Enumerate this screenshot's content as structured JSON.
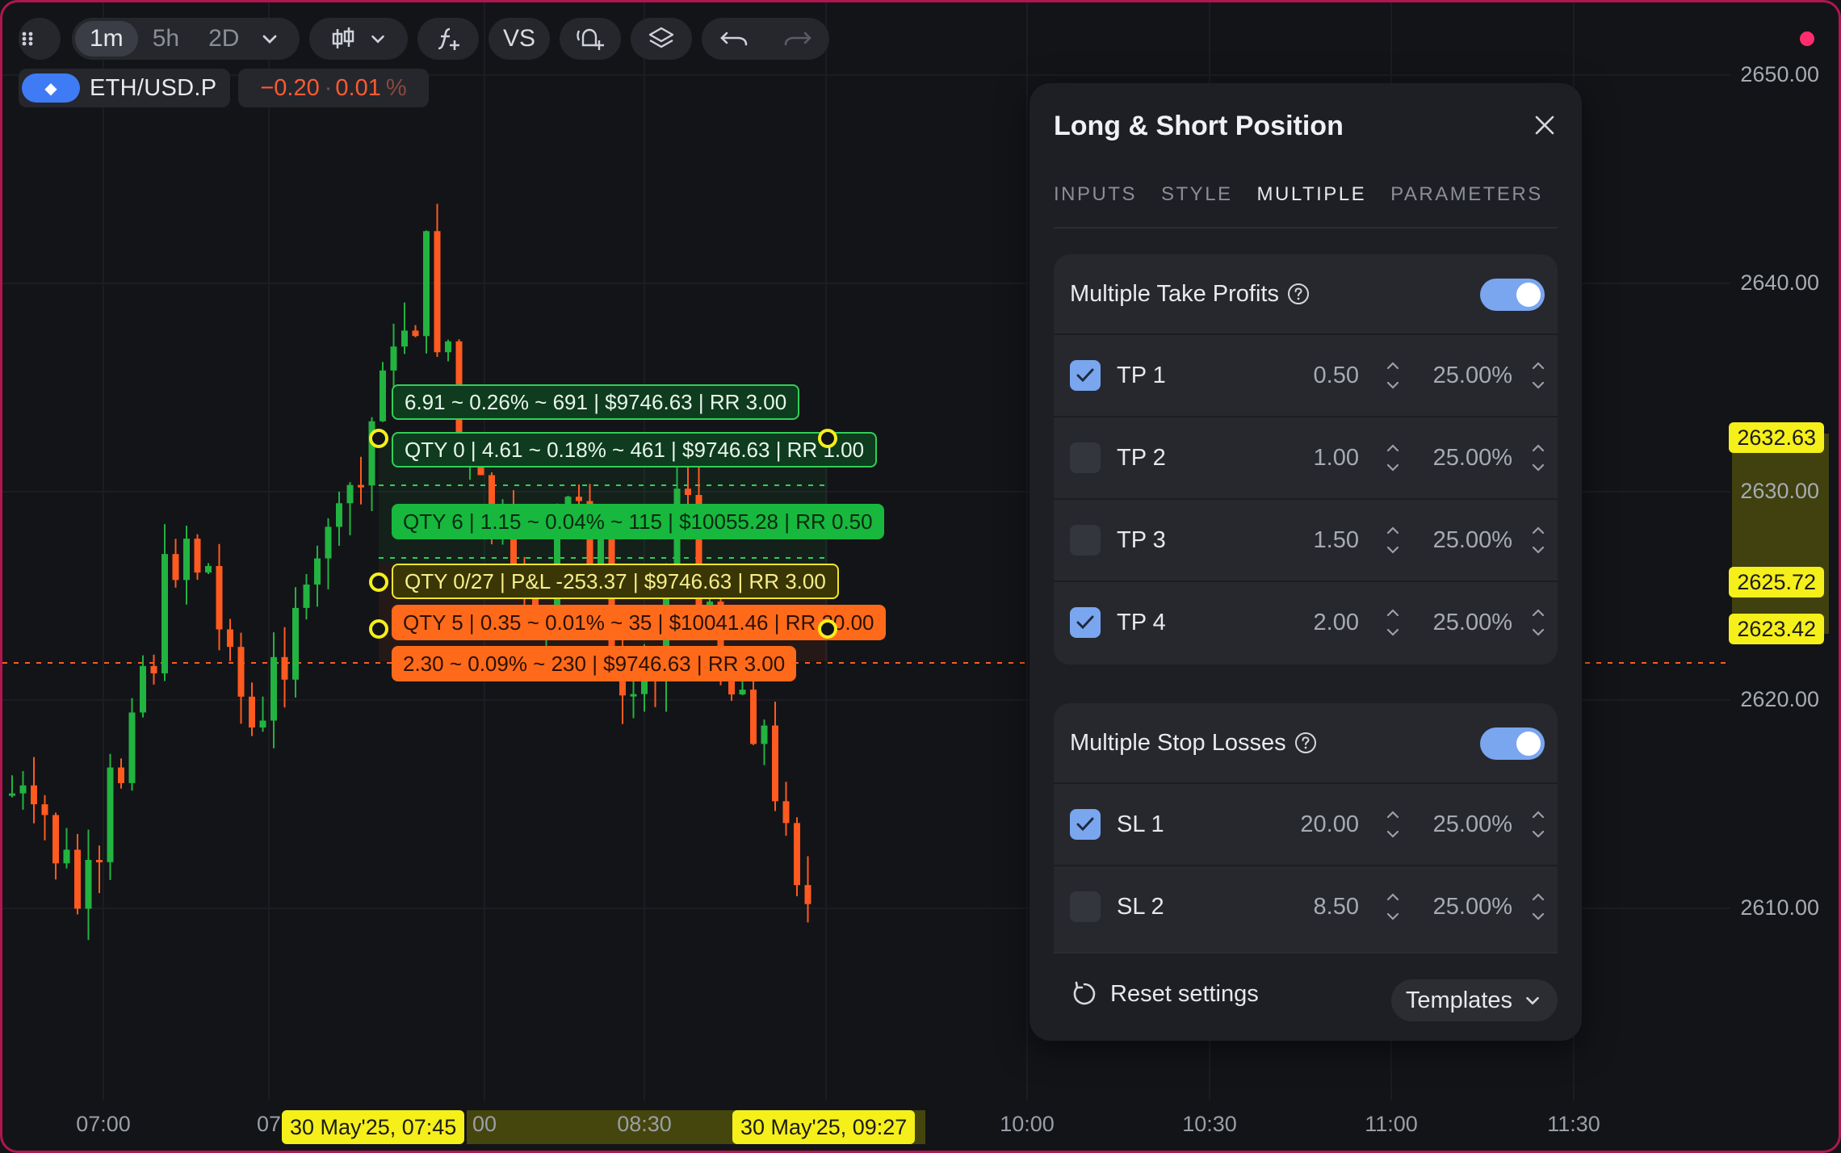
{
  "toolbar": {
    "timeframes": [
      "1m",
      "5h",
      "2D"
    ],
    "active_timeframe": "1m",
    "compare_label": "VS",
    "icons": [
      "drag-handle-icon",
      "chevron-down-icon",
      "candles-icon",
      "indicator-icon",
      "alert-add-icon",
      "layers-icon",
      "undo-icon",
      "redo-icon"
    ]
  },
  "symbol": {
    "name": "ETH/USD.P",
    "change": "−0.20",
    "separator": "·",
    "change_pct": "0.01",
    "pct_sign": "%"
  },
  "price_axis": {
    "labels": [
      "2650.00",
      "2640.00",
      "2630.00",
      "2620.00",
      "2610.00"
    ],
    "tags": [
      "2632.63",
      "2625.72",
      "2623.42"
    ]
  },
  "time_axis": {
    "labels": [
      "07:00",
      "07",
      "00",
      "08:30",
      "10:00",
      "10:30",
      "11:00",
      "11:30"
    ],
    "tags": [
      "30 May'25, 07:45",
      "30 May'25, 09:27"
    ]
  },
  "position_labels": {
    "tp_target": "6.91 ~ 0.26% ~ 691 | $9746.63 | RR 3.00",
    "tp1": "QTY 0 | 4.61 ~ 0.18% ~ 461 | $9746.63 | RR 1.00",
    "tp_hit": "QTY 6 | 1.15 ~ 0.04% ~ 115 | $10055.28 | RR 0.50",
    "entry": "QTY 0/27 | P&L -253.37 | $9746.63 | RR 3.00",
    "sl1": "QTY 5 | 0.35 ~ 0.01% ~ 35 | $10041.46 | RR 20.00",
    "sl_target": "2.30 ~ 0.09% ~ 230 | $9746.63 | RR 3.00"
  },
  "panel": {
    "title": "Long & Short Position",
    "tabs": [
      "INPUTS",
      "STYLE",
      "MULTIPLE",
      "PARAMETERS"
    ],
    "active_tab": "MULTIPLE",
    "take_profits": {
      "title": "Multiple Take Profits",
      "enabled": true,
      "rows": [
        {
          "label": "TP 1",
          "value": "0.50",
          "percent": "25.00%",
          "checked": true
        },
        {
          "label": "TP 2",
          "value": "1.00",
          "percent": "25.00%",
          "checked": false
        },
        {
          "label": "TP 3",
          "value": "1.50",
          "percent": "25.00%",
          "checked": false
        },
        {
          "label": "TP 4",
          "value": "2.00",
          "percent": "25.00%",
          "checked": true
        }
      ]
    },
    "stop_losses": {
      "title": "Multiple Stop Losses",
      "enabled": true,
      "rows": [
        {
          "label": "SL 1",
          "value": "20.00",
          "percent": "25.00%",
          "checked": true
        },
        {
          "label": "SL 2",
          "value": "8.50",
          "percent": "25.00%",
          "checked": false
        }
      ]
    },
    "reset_label": "Reset settings",
    "templates_label": "Templates"
  },
  "colors": {
    "accent": "#7aa6f0",
    "up": "#22b340",
    "down": "#ff5a1f",
    "highlight": "#f5ef1a",
    "frame": "#b0164f"
  }
}
